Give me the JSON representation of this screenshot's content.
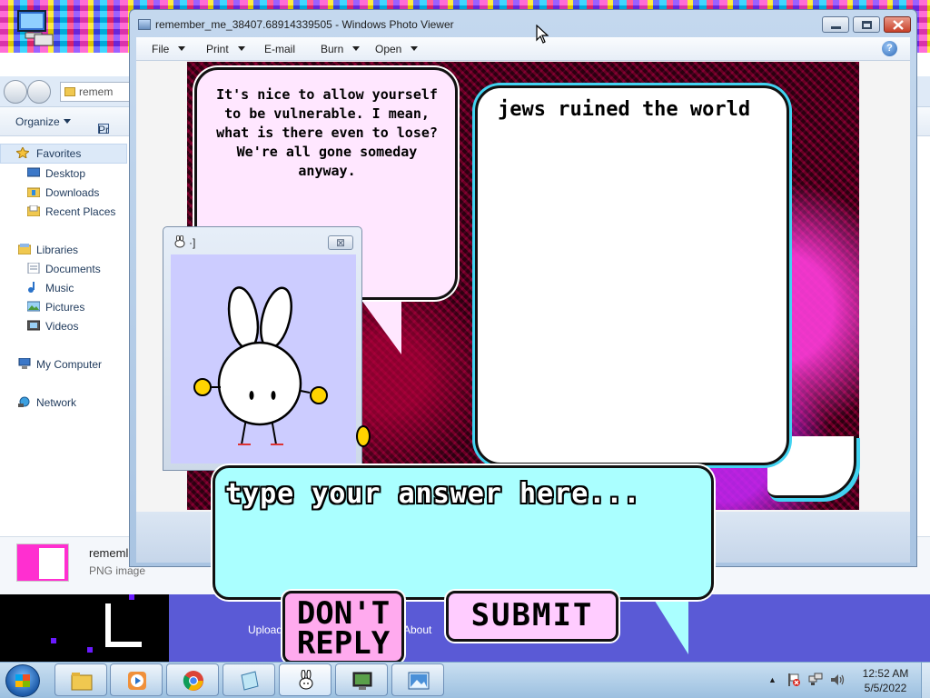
{
  "photo_viewer": {
    "title": "remember_me_38407.68914339505 - Windows Photo Viewer",
    "menu": {
      "file": "File",
      "print": "Print",
      "email": "E-mail",
      "burn": "Burn",
      "open": "Open",
      "help": "?"
    }
  },
  "explorer": {
    "address": "remem",
    "toolbar": {
      "organize": "Organize",
      "preview": "Pr"
    },
    "sidebar": {
      "favorites": "Favorites",
      "favorites_items": [
        "Desktop",
        "Downloads",
        "Recent Places"
      ],
      "libraries": "Libraries",
      "libraries_items": [
        "Documents",
        "Music",
        "Pictures",
        "Videos"
      ],
      "computer": "My Computer",
      "network": "Network"
    },
    "details": {
      "file_name": "rememl",
      "file_type": "PNG image"
    }
  },
  "image": {
    "speech_left": "It's nice to allow yourself to be vulnerable. I mean, what is there even to lose? We're all gone someday anyway.",
    "speech_right": "jews ruined the world"
  },
  "bunny_window": {
    "title": "·]",
    "close": "⊠"
  },
  "dialog": {
    "answer_placeholder": "type your answer here...",
    "dont_reply": "DON'T REPLY",
    "submit": "SUBMIT"
  },
  "desktop_strip": {
    "upload": "Upload",
    "about": "About"
  },
  "taskbar": {
    "clock_time": "12:52 AM",
    "clock_date": "5/5/2022"
  }
}
